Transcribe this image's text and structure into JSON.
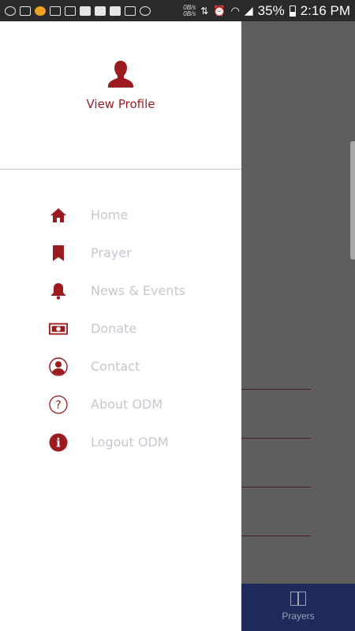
{
  "status_bar": {
    "battery": "35%",
    "time": "2:16 PM",
    "net_up": "0B/s",
    "net_down": "0B/s"
  },
  "drawer": {
    "profile": {
      "label": "View Profile"
    },
    "menu": [
      {
        "label": "Home",
        "icon": "home-icon"
      },
      {
        "label": "Prayer",
        "icon": "bookmark-icon"
      },
      {
        "label": "News & Events",
        "icon": "bell-icon"
      },
      {
        "label": "Donate",
        "icon": "money-icon"
      },
      {
        "label": "Contact",
        "icon": "contact-icon"
      },
      {
        "label": "About ODM",
        "icon": "question-icon"
      },
      {
        "label": "Logout ODM",
        "icon": "info-icon"
      }
    ]
  },
  "bottom_nav": {
    "active_tab": "Prayers"
  },
  "colors": {
    "accent": "#9b1b1f",
    "menu_text": "#c3c8d0",
    "bottom_nav_bg": "#1d2a5a",
    "scrim": "#5e5e5e"
  }
}
